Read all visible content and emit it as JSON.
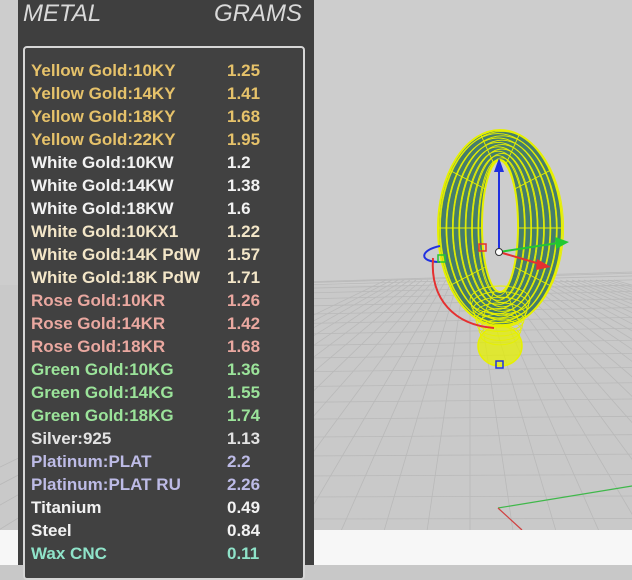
{
  "panel": {
    "header_metal": "METAL",
    "header_grams": "GRAMS",
    "rows": [
      {
        "name": "Yellow Gold:10KY",
        "grams": "1.25",
        "color": "#e6c26a"
      },
      {
        "name": "Yellow Gold:14KY",
        "grams": "1.41",
        "color": "#e6c26a"
      },
      {
        "name": "Yellow Gold:18KY",
        "grams": "1.68",
        "color": "#e6c26a"
      },
      {
        "name": "Yellow Gold:22KY",
        "grams": "1.95",
        "color": "#e6c26a"
      },
      {
        "name": "White Gold:10KW",
        "grams": "1.2",
        "color": "#f2f2f2"
      },
      {
        "name": "White Gold:14KW",
        "grams": "1.38",
        "color": "#f2f2f2"
      },
      {
        "name": "White Gold:18KW",
        "grams": "1.6",
        "color": "#f2f2f2"
      },
      {
        "name": "White Gold:10KX1",
        "grams": "1.22",
        "color": "#f3e6c8"
      },
      {
        "name": "White Gold:14K PdW",
        "grams": "1.57",
        "color": "#f3e6c8"
      },
      {
        "name": "White Gold:18K PdW",
        "grams": "1.71",
        "color": "#f3e6c8"
      },
      {
        "name": "Rose Gold:10KR",
        "grams": "1.26",
        "color": "#eaa8a0"
      },
      {
        "name": "Rose Gold:14KR",
        "grams": "1.42",
        "color": "#eaa8a0"
      },
      {
        "name": "Rose Gold:18KR",
        "grams": "1.68",
        "color": "#eaa8a0"
      },
      {
        "name": "Green Gold:10KG",
        "grams": "1.36",
        "color": "#9be39a"
      },
      {
        "name": "Green Gold:14KG",
        "grams": "1.55",
        "color": "#9be39a"
      },
      {
        "name": "Green Gold:18KG",
        "grams": "1.74",
        "color": "#9be39a"
      },
      {
        "name": "Silver:925",
        "grams": "1.13",
        "color": "#e3e3e3"
      },
      {
        "name": "Platinum:PLAT",
        "grams": "2.2",
        "color": "#bdbbe6"
      },
      {
        "name": "Platinum:PLAT RU",
        "grams": "2.26",
        "color": "#bdbbe6"
      },
      {
        "name": "Titanium",
        "grams": "0.49",
        "color": "#f2f2f2"
      },
      {
        "name": "Steel",
        "grams": "0.84",
        "color": "#f2f2f2"
      },
      {
        "name": "Wax  CNC",
        "grams": "0.11",
        "color": "#8fe3c9"
      }
    ]
  },
  "viewport": {
    "model_color": "#e6f000",
    "model_fill": "#2d6f5a",
    "axis_x_color": "#e53030",
    "axis_y_color": "#22c832",
    "axis_z_color": "#2030e0"
  }
}
